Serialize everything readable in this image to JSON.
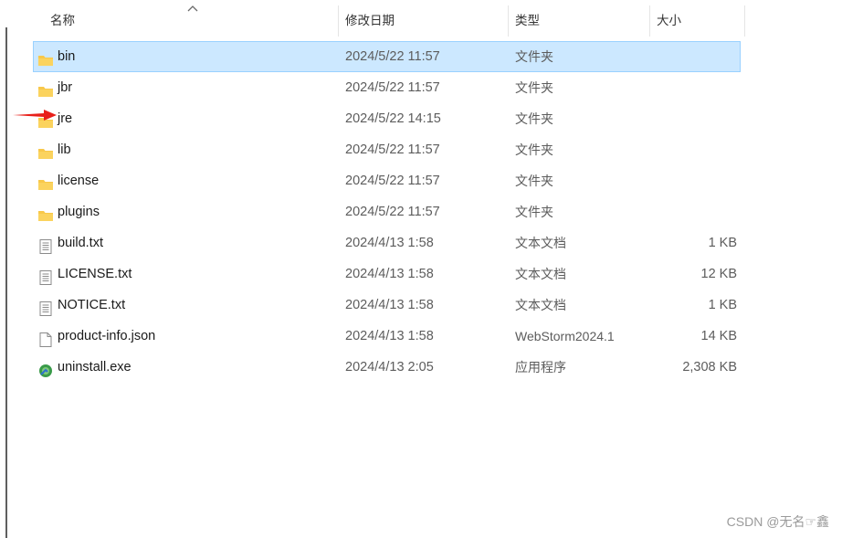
{
  "header": {
    "name_label": "名称",
    "date_label": "修改日期",
    "type_label": "类型",
    "size_label": "大小"
  },
  "files": [
    {
      "name": "bin",
      "date": "2024/5/22 11:57",
      "type": "文件夹",
      "size": "",
      "icon": "folder-icon",
      "selected": true
    },
    {
      "name": "jbr",
      "date": "2024/5/22 11:57",
      "type": "文件夹",
      "size": "",
      "icon": "folder-icon"
    },
    {
      "name": "jre",
      "date": "2024/5/22 14:15",
      "type": "文件夹",
      "size": "",
      "icon": "folder-icon"
    },
    {
      "name": "lib",
      "date": "2024/5/22 11:57",
      "type": "文件夹",
      "size": "",
      "icon": "folder-icon"
    },
    {
      "name": "license",
      "date": "2024/5/22 11:57",
      "type": "文件夹",
      "size": "",
      "icon": "folder-icon"
    },
    {
      "name": "plugins",
      "date": "2024/5/22 11:57",
      "type": "文件夹",
      "size": "",
      "icon": "folder-icon"
    },
    {
      "name": "build.txt",
      "date": "2024/4/13 1:58",
      "type": "文本文档",
      "size": "1 KB",
      "icon": "text-file-icon"
    },
    {
      "name": "LICENSE.txt",
      "date": "2024/4/13 1:58",
      "type": "文本文档",
      "size": "12 KB",
      "icon": "text-file-icon"
    },
    {
      "name": "NOTICE.txt",
      "date": "2024/4/13 1:58",
      "type": "文本文档",
      "size": "1 KB",
      "icon": "text-file-icon"
    },
    {
      "name": "product-info.json",
      "date": "2024/4/13 1:58",
      "type": "WebStorm2024.1",
      "size": "14 KB",
      "icon": "blank-file-icon"
    },
    {
      "name": "uninstall.exe",
      "date": "2024/4/13 2:05",
      "type": "应用程序",
      "size": "2,308 KB",
      "icon": "uninstaller-icon"
    }
  ],
  "annotation": {
    "icon": "red-arrow-icon",
    "color": "#e8201a"
  },
  "watermark": "CSDN @无名☞鑫",
  "colors": {
    "selection": "#cce8ff",
    "selection_border": "#99d1ff",
    "folder": "#f8c84a"
  }
}
